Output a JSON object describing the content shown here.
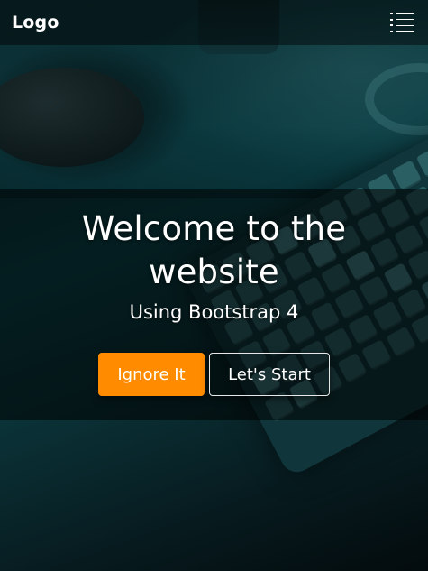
{
  "navbar": {
    "brand": "Logo",
    "menu_icon": "list-menu-icon"
  },
  "hero": {
    "title": "Welcome to the website",
    "subtitle": "Using Bootstrap 4",
    "buttons": {
      "primary_label": "Ignore It",
      "secondary_label": "Let's Start"
    }
  },
  "colors": {
    "accent": "#ff8c00",
    "overlay": "rgba(0,0,0,0.55)",
    "text": "#ffffff"
  }
}
